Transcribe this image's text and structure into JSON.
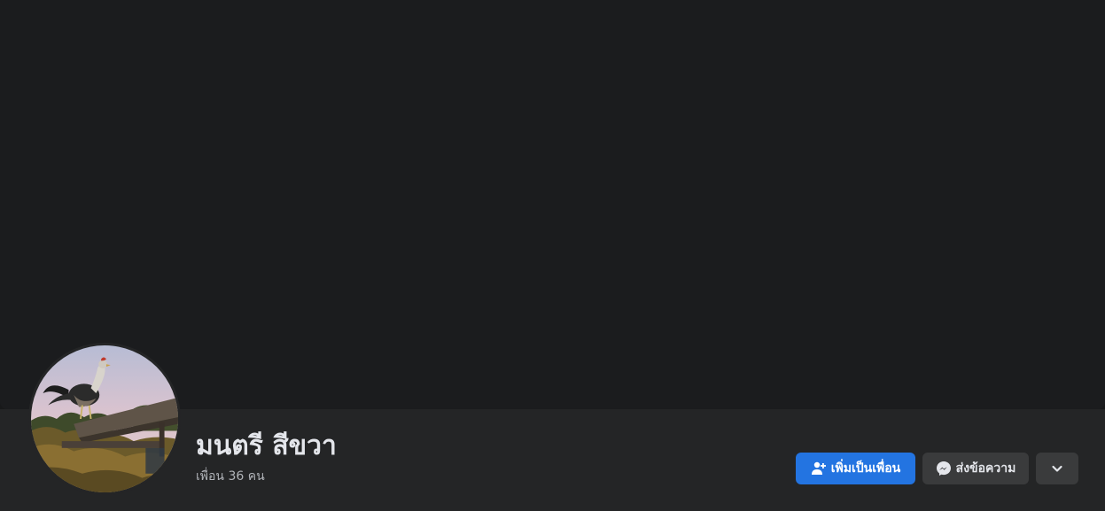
{
  "profile": {
    "name": "มนตรี สีขวา",
    "friends_count": "เพื่อน 36 คน"
  },
  "actions": {
    "add_friend_label": "เพิ่มเป็นเพื่อน",
    "add_friend_icon": "person-add-icon",
    "message_label": "ส่งข้อความ",
    "message_icon": "messenger-icon",
    "more_icon": "chevron-down-icon"
  },
  "colors": {
    "page_background": "#18191a",
    "cover_background": "#1b1c1e",
    "header_background": "#242526",
    "primary_button": "#2374e1",
    "secondary_button": "#3a3b3c",
    "primary_text": "#e4e6eb",
    "secondary_text": "#b0b3b8"
  }
}
